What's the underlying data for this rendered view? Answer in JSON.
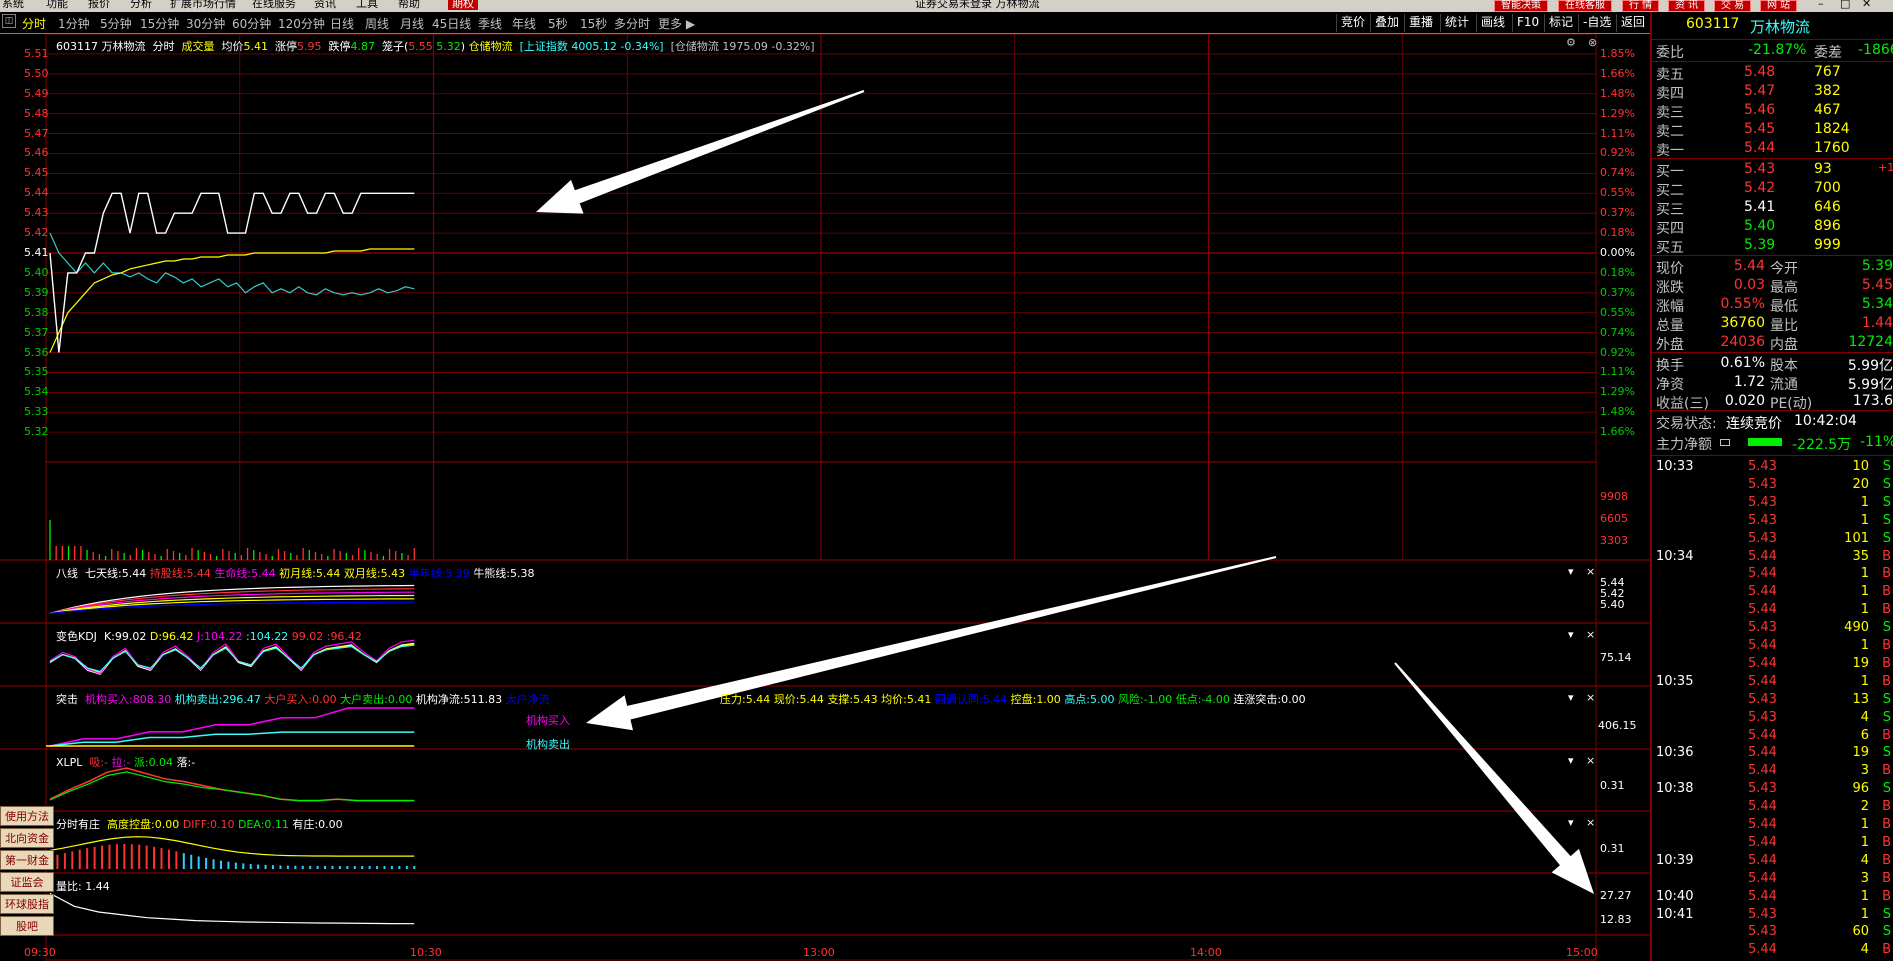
{
  "menubar": {
    "items": [
      "系统",
      "功能",
      "报价",
      "分析",
      "扩展市场行情",
      "在线服务",
      "资讯",
      "工具",
      "帮助",
      "期权"
    ],
    "title": "证券交易未登录 万林物流",
    "buttons": [
      "智能决策",
      "在线客服",
      "行 情",
      "资 讯",
      "交 易",
      "网 站"
    ]
  },
  "toolbar": {
    "periods": [
      "分时",
      "1分钟",
      "5分钟",
      "15分钟",
      "30分钟",
      "60分钟",
      "120分钟",
      "日线",
      "周线",
      "月线",
      "45日线",
      "季线",
      "年线",
      "5秒",
      "15秒",
      "多分时",
      "更多 ▶"
    ],
    "right_tools": [
      "竞价",
      "叠加",
      "重播",
      "统计",
      "画线",
      "F10",
      "标记",
      "-自选",
      "返回"
    ]
  },
  "main": {
    "code_name": "603117 万林物流",
    "mode": "分时",
    "volume_label": "成交量",
    "avg_label": "均价",
    "avg_value": "5.41",
    "up_limit_label": "涨停",
    "up_limit_value": "5.95",
    "down_limit_label": "跌停",
    "down_limit_value": "4.87",
    "cage_label": "笼子(",
    "cage_low": "5.55",
    "cage_high": "5.32",
    "cage_end": ")",
    "sector_label": "仓储物流",
    "index_text": "[上证指数 4005.12 -0.34%]",
    "sector_text": "[仓储物流 1975.09 -0.32%]",
    "price_axis": [
      "5.51",
      "5.50",
      "5.49",
      "5.48",
      "5.47",
      "5.46",
      "5.45",
      "5.44",
      "5.43",
      "5.42",
      "5.41",
      "5.40",
      "5.39",
      "5.38",
      "5.37",
      "5.36",
      "5.35",
      "5.34",
      "5.33",
      "5.32"
    ],
    "pct_axis": [
      "1.85%",
      "1.66%",
      "1.48%",
      "1.29%",
      "1.11%",
      "0.92%",
      "0.74%",
      "0.55%",
      "0.37%",
      "0.18%",
      "0.00%",
      "0.18%",
      "0.37%",
      "0.55%",
      "0.74%",
      "0.92%",
      "1.11%",
      "1.29%",
      "1.48%",
      "1.66%"
    ],
    "vol_axis": [
      "9908",
      "6605",
      "3303"
    ],
    "time_axis": [
      "09:30",
      "10:30",
      "13:00",
      "14:00",
      "15:00"
    ]
  },
  "panels": {
    "bax": {
      "title": "八线",
      "items": [
        {
          "label": "七天线:",
          "value": "5.44",
          "color": "#ffffff"
        },
        {
          "label": "持股线:",
          "value": "5.44",
          "color": "#ff3333"
        },
        {
          "label": "生命线:",
          "value": "5.44",
          "color": "#ff00ff"
        },
        {
          "label": "初月线:",
          "value": "5.44",
          "color": "#ffff00"
        },
        {
          "label": "双月线:",
          "value": "5.43",
          "color": "#ffff00"
        },
        {
          "label": "半年线:",
          "value": "5.39",
          "color": "#0000ff"
        },
        {
          "label": "牛熊线:",
          "value": "5.38",
          "color": "#ffffff"
        }
      ],
      "axis": [
        "5.44",
        "5.42",
        "5.40"
      ]
    },
    "kdj": {
      "title": "变色KDJ",
      "items": [
        {
          "label": "K:",
          "value": "99.02",
          "color": "#ffffff"
        },
        {
          "label": "D:",
          "value": "96.42",
          "color": "#ffff00"
        },
        {
          "label": "J:",
          "value": "104.22",
          "color": "#ff00ff"
        },
        {
          "label": ":",
          "value": "104.22",
          "color": "#33ffff"
        },
        {
          "label": "",
          "value": "99.02",
          "color": "#ff3333"
        },
        {
          "label": ":",
          "value": "96.42",
          "color": "#ff3333"
        }
      ],
      "axis": [
        "75.14"
      ]
    },
    "tuji": {
      "title": "突击",
      "items": [
        {
          "label": "机构买入:",
          "value": "808.30",
          "color": "#ff00ff"
        },
        {
          "label": "机构卖出:",
          "value": "296.47",
          "color": "#33ffff"
        },
        {
          "label": "大户买入:",
          "value": "0.00",
          "color": "#ff3333"
        },
        {
          "label": "大户卖出:",
          "value": "0.00",
          "color": "#00ee00"
        },
        {
          "label": "机构净流:",
          "value": "511.83",
          "color": "#ffffff"
        },
        {
          "label": "大户净流",
          "value": "",
          "color": "#0000ff"
        }
      ],
      "items2": [
        {
          "label": "压力:",
          "value": "5.44",
          "color": "#ffff00"
        },
        {
          "label": "现价:",
          "value": "5.44",
          "color": "#ffff00"
        },
        {
          "label": "支撑:",
          "value": "5.43",
          "color": "#ffff00"
        },
        {
          "label": "均价:",
          "value": "5.41",
          "color": "#ffff00"
        },
        {
          "label": "回调认同:",
          "value": "5.44",
          "color": "#0000ff"
        },
        {
          "label": "控盘:",
          "value": "1.00",
          "color": "#ffff00"
        },
        {
          "label": "高点:",
          "value": "5.00",
          "color": "#33ffff"
        },
        {
          "label": "风险:",
          "value": "-1.00",
          "color": "#00ee00"
        },
        {
          "label": "低点:",
          "value": "-4.00",
          "color": "#00ee00"
        },
        {
          "label": "连涨突击:",
          "value": "0.00",
          "color": "#ffffff"
        }
      ],
      "buy_tag": "机构买入",
      "sell_tag": "机构卖出",
      "axis": [
        "406.15"
      ]
    },
    "xlpl": {
      "title": "XLPL",
      "items": [
        {
          "label": "吸:",
          "value": "-",
          "color": "#ff3333"
        },
        {
          "label": "拉:",
          "value": "-",
          "color": "#ff00ff"
        },
        {
          "label": "派:",
          "value": "0.04",
          "color": "#00ee00"
        },
        {
          "label": "落:",
          "value": "-",
          "color": "#ffffff"
        }
      ],
      "axis": [
        "0.31"
      ]
    },
    "fsyz": {
      "title": "分时有庄",
      "items": [
        {
          "label": "高度控盘:",
          "value": "0.00",
          "color": "#ffff00"
        },
        {
          "label": "DIFF:",
          "value": "0.10",
          "color": "#ff3333"
        },
        {
          "label": "DEA:",
          "value": "0.11",
          "color": "#00ee00"
        },
        {
          "label": "有庄:",
          "value": "0.00",
          "color": "#ffffff"
        }
      ],
      "axis": [
        "0.31"
      ]
    },
    "lb": {
      "title": "量比:",
      "value": "1.44",
      "axis": [
        "27.27",
        "12.83"
      ]
    }
  },
  "side_buttons": [
    "使用方法",
    "北向资金",
    "第一财金",
    "证监会",
    "环球股指",
    "股吧"
  ],
  "quote": {
    "code": "603117",
    "name": "万林物流",
    "weibi_label": "委比",
    "weibi_value": "-21.87%",
    "weicha_label": "委差",
    "weicha_value": "-1866",
    "asks": [
      {
        "label": "卖五",
        "price": "5.48",
        "vol": "767"
      },
      {
        "label": "卖四",
        "price": "5.47",
        "vol": "382"
      },
      {
        "label": "卖三",
        "price": "5.46",
        "vol": "467"
      },
      {
        "label": "卖二",
        "price": "5.45",
        "vol": "1824"
      },
      {
        "label": "卖一",
        "price": "5.44",
        "vol": "1760"
      }
    ],
    "bids": [
      {
        "label": "买一",
        "price": "5.43",
        "vol": "93",
        "chg": "+1",
        "pcolor": "#ff3333"
      },
      {
        "label": "买二",
        "price": "5.42",
        "vol": "700",
        "chg": "",
        "pcolor": "#ff3333"
      },
      {
        "label": "买三",
        "price": "5.41",
        "vol": "646",
        "chg": "",
        "pcolor": "#ffffff"
      },
      {
        "label": "买四",
        "price": "5.40",
        "vol": "896",
        "chg": "",
        "pcolor": "#00ee00"
      },
      {
        "label": "买五",
        "price": "5.39",
        "vol": "999",
        "chg": "",
        "pcolor": "#00ee00"
      }
    ],
    "stats": [
      {
        "l1": "现价",
        "v1": "5.44",
        "c1": "#ff3333",
        "l2": "今开",
        "v2": "5.39",
        "c2": "#00ee00"
      },
      {
        "l1": "涨跌",
        "v1": "0.03",
        "c1": "#ff3333",
        "l2": "最高",
        "v2": "5.45",
        "c2": "#ff3333"
      },
      {
        "l1": "涨幅",
        "v1": "0.55%",
        "c1": "#ff3333",
        "l2": "最低",
        "v2": "5.34",
        "c2": "#00ee00"
      },
      {
        "l1": "总量",
        "v1": "36760",
        "c1": "#ffff00",
        "l2": "量比",
        "v2": "1.44",
        "c2": "#ff3333"
      },
      {
        "l1": "外盘",
        "v1": "24036",
        "c1": "#ff3333",
        "l2": "内盘",
        "v2": "12724",
        "c2": "#00ee00"
      }
    ],
    "stats2": [
      {
        "l1": "换手",
        "v1": "0.61%",
        "c1": "#ffffff",
        "l2": "股本",
        "v2": "5.99亿",
        "c2": "#ffffff"
      },
      {
        "l1": "净资",
        "v1": "1.72",
        "c1": "#ffffff",
        "l2": "流通",
        "v2": "5.99亿",
        "c2": "#ffffff"
      },
      {
        "l1": "收益(三)",
        "v1": "0.020",
        "c1": "#ffffff",
        "l2": "PE(动)",
        "v2": "173.6",
        "c2": "#ffffff"
      }
    ],
    "trade_state_label": "交易状态:",
    "trade_state_value": "连续竞价",
    "trade_time": "10:42:04",
    "main_flow_label": "主力净额",
    "main_flow_value": "-222.5万",
    "main_flow_pct": "-11%",
    "ticks": [
      {
        "t": "10:33",
        "p": "5.43",
        "v": "10",
        "d": "S"
      },
      {
        "t": "",
        "p": "5.43",
        "v": "20",
        "d": "S"
      },
      {
        "t": "",
        "p": "5.43",
        "v": "1",
        "d": "S"
      },
      {
        "t": "",
        "p": "5.43",
        "v": "1",
        "d": "S"
      },
      {
        "t": "",
        "p": "5.43",
        "v": "101",
        "d": "S"
      },
      {
        "t": "10:34",
        "p": "5.44",
        "v": "35",
        "d": "B"
      },
      {
        "t": "",
        "p": "5.44",
        "v": "1",
        "d": "B"
      },
      {
        "t": "",
        "p": "5.44",
        "v": "1",
        "d": "B"
      },
      {
        "t": "",
        "p": "5.44",
        "v": "1",
        "d": "B"
      },
      {
        "t": "",
        "p": "5.43",
        "v": "490",
        "d": "S"
      },
      {
        "t": "",
        "p": "5.44",
        "v": "1",
        "d": "B"
      },
      {
        "t": "",
        "p": "5.44",
        "v": "19",
        "d": "B"
      },
      {
        "t": "10:35",
        "p": "5.44",
        "v": "1",
        "d": "B"
      },
      {
        "t": "",
        "p": "5.43",
        "v": "13",
        "d": "S"
      },
      {
        "t": "",
        "p": "5.43",
        "v": "4",
        "d": "S"
      },
      {
        "t": "",
        "p": "5.44",
        "v": "6",
        "d": "B"
      },
      {
        "t": "10:36",
        "p": "5.44",
        "v": "19",
        "d": "S"
      },
      {
        "t": "",
        "p": "5.44",
        "v": "3",
        "d": "B"
      },
      {
        "t": "10:38",
        "p": "5.43",
        "v": "96",
        "d": "S"
      },
      {
        "t": "",
        "p": "5.44",
        "v": "2",
        "d": "B"
      },
      {
        "t": "",
        "p": "5.44",
        "v": "1",
        "d": "B"
      },
      {
        "t": "",
        "p": "5.44",
        "v": "1",
        "d": "B"
      },
      {
        "t": "10:39",
        "p": "5.44",
        "v": "4",
        "d": "B"
      },
      {
        "t": "",
        "p": "5.44",
        "v": "3",
        "d": "B"
      },
      {
        "t": "10:40",
        "p": "5.44",
        "v": "1",
        "d": "B"
      },
      {
        "t": "10:41",
        "p": "5.43",
        "v": "1",
        "d": "S"
      },
      {
        "t": "",
        "p": "5.43",
        "v": "60",
        "d": "S"
      },
      {
        "t": "",
        "p": "5.44",
        "v": "4",
        "d": "B"
      }
    ]
  },
  "colors": {
    "grid": "#800000",
    "price_line": "#ffffff",
    "avg_line": "#ffff00",
    "index_line": "#33cccc",
    "up": "#ff3333",
    "down": "#00ee00",
    "arrow": "#ffffff"
  },
  "icons": [
    "minimize-icon",
    "close-icon",
    "dropdown-icon",
    "restore-icon"
  ]
}
